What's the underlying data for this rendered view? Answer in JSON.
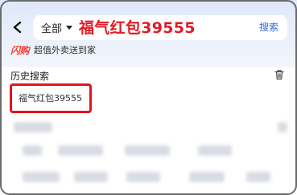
{
  "header": {
    "scope_label": "全部",
    "query": "福气红包39555",
    "search_button": "搜索"
  },
  "flash_banner": {
    "logo": "闪购",
    "text": "超值外卖送到家",
    "logo_color": "#ff3b30"
  },
  "history": {
    "title": "历史搜索",
    "items": [
      "福气红包39555"
    ]
  },
  "colors": {
    "accent_red": "#e21b24",
    "link_blue": "#2f6bdb"
  },
  "icons": [
    "back-arrow-icon",
    "caret-down-icon",
    "trash-icon"
  ]
}
